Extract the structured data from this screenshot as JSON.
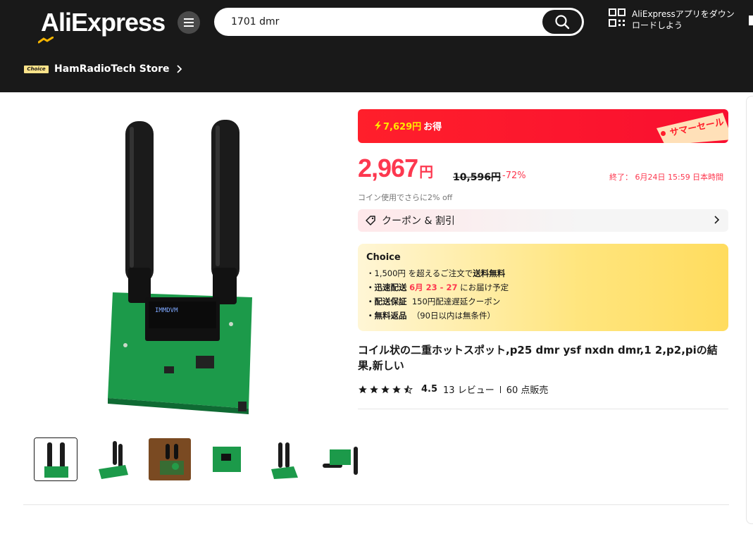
{
  "header": {
    "logo_text": "AliExpress",
    "search_value": "1701 dmr",
    "app_download_label": "AliExpressアプリをダウンロードしよう",
    "store_badge": "Choice",
    "store_name": "HamRadioTech Store"
  },
  "colors": {
    "brand_red": "#fd384f",
    "header_bg": "#191919",
    "choice_yellow": "#ffe57d"
  },
  "sale": {
    "savings_amount": "7,629円",
    "savings_suffix": "お得",
    "event_label": "サマーセール"
  },
  "price": {
    "current": "2,967",
    "currency": "円",
    "original": "10,596円",
    "discount": "-72%",
    "ends": "終了： 6月24日 15:59 日本時間",
    "coin_note": "コイン使用でさらに2% off"
  },
  "coupon": {
    "label": "クーポン & 割引"
  },
  "choice": {
    "title": "Choice",
    "line1_pre": "・1,500円 を超えるご注文で",
    "line1_bold": "送料無料",
    "line2_bold": "・迅速配送",
    "line2_date": "6月 23 - 27",
    "line2_post": "にお届け予定",
    "line3_bold": "・配送保証",
    "line3_post": "150円配達遅延クーポン",
    "line4_bold": "・無料返品",
    "line4_post": "（90日以内は無条件）"
  },
  "product": {
    "title": "コイル状の二重ホットスポット,p25 dmr ysf nxdn dmr,1 2,p2,piの結果,新しい",
    "rating": 4.5,
    "rating_label": "4.5",
    "reviews": "13 レビュー",
    "sold": "60 点販売",
    "thumbnail_count": 6
  },
  "icons": [
    "menu-icon",
    "search-icon",
    "qr-code-icon",
    "chevron-right-icon",
    "lightning-icon",
    "tag-icon",
    "star-icon"
  ]
}
